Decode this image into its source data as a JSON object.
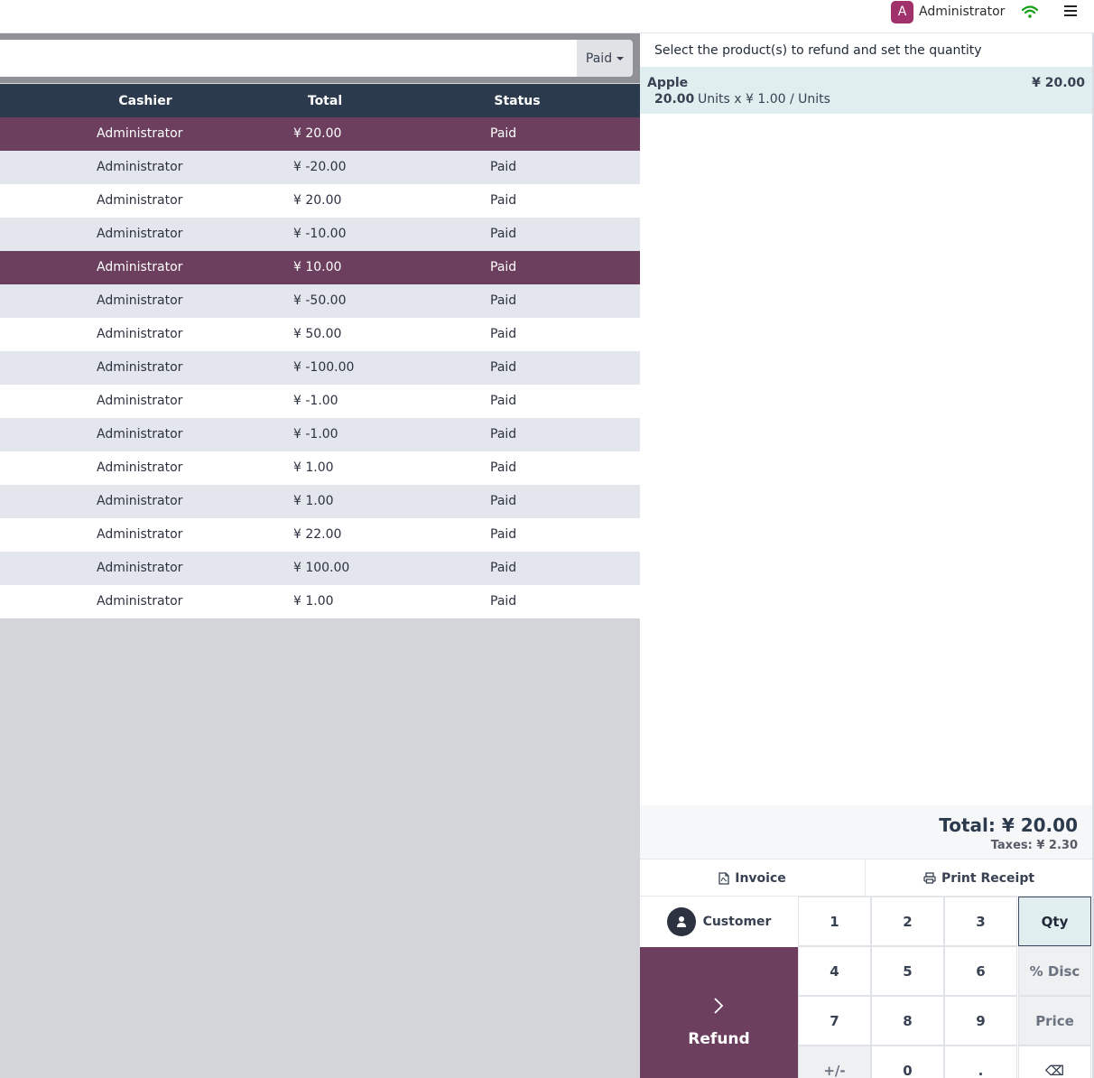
{
  "header": {
    "avatar_letter": "A",
    "user_name": "Administrator",
    "wifi_icon": "wifi-icon",
    "menu_icon": "hamburger-menu-icon"
  },
  "filter": {
    "search_value": "",
    "status_label": "Paid"
  },
  "table": {
    "columns": [
      "Cashier",
      "Total",
      "Status"
    ],
    "rows": [
      {
        "cashier": "Administrator",
        "total": "¥ 20.00",
        "status": "Paid",
        "selected": true
      },
      {
        "cashier": "Administrator",
        "total": "¥ -20.00",
        "status": "Paid",
        "selected": false
      },
      {
        "cashier": "Administrator",
        "total": "¥ 20.00",
        "status": "Paid",
        "selected": false
      },
      {
        "cashier": "Administrator",
        "total": "¥ -10.00",
        "status": "Paid",
        "selected": false
      },
      {
        "cashier": "Administrator",
        "total": "¥ 10.00",
        "status": "Paid",
        "selected": true
      },
      {
        "cashier": "Administrator",
        "total": "¥ -50.00",
        "status": "Paid",
        "selected": false
      },
      {
        "cashier": "Administrator",
        "total": "¥ 50.00",
        "status": "Paid",
        "selected": false
      },
      {
        "cashier": "Administrator",
        "total": "¥ -100.00",
        "status": "Paid",
        "selected": false
      },
      {
        "cashier": "Administrator",
        "total": "¥ -1.00",
        "status": "Paid",
        "selected": false
      },
      {
        "cashier": "Administrator",
        "total": "¥ -1.00",
        "status": "Paid",
        "selected": false
      },
      {
        "cashier": "Administrator",
        "total": "¥ 1.00",
        "status": "Paid",
        "selected": false
      },
      {
        "cashier": "Administrator",
        "total": "¥ 1.00",
        "status": "Paid",
        "selected": false
      },
      {
        "cashier": "Administrator",
        "total": "¥ 22.00",
        "status": "Paid",
        "selected": false
      },
      {
        "cashier": "Administrator",
        "total": "¥ 100.00",
        "status": "Paid",
        "selected": false
      },
      {
        "cashier": "Administrator",
        "total": "¥ 1.00",
        "status": "Paid",
        "selected": false
      }
    ]
  },
  "refund_panel": {
    "instruction": "Select the product(s) to refund and set the quantity",
    "line": {
      "product": "Apple",
      "price": "¥ 20.00",
      "qty": "20.00",
      "unit_info": "Units x ¥ 1.00 / Units"
    },
    "total": "Total: ¥ 20.00",
    "taxes": "Taxes: ¥ 2.30",
    "invoice_label": "Invoice",
    "print_label": "Print Receipt",
    "customer_label": "Customer",
    "refund_label": "Refund"
  },
  "numpad": {
    "keys": [
      "1",
      "2",
      "3",
      "Qty",
      "4",
      "5",
      "6",
      "% Disc",
      "7",
      "8",
      "9",
      "Price",
      "+/-",
      "0",
      ".",
      "⌫"
    ],
    "active_mode": "Qty"
  },
  "colors": {
    "accent": "#6b3f5d",
    "table_header": "#2c3a4d",
    "avatar": "#a0316b",
    "wifi": "#14a014"
  }
}
